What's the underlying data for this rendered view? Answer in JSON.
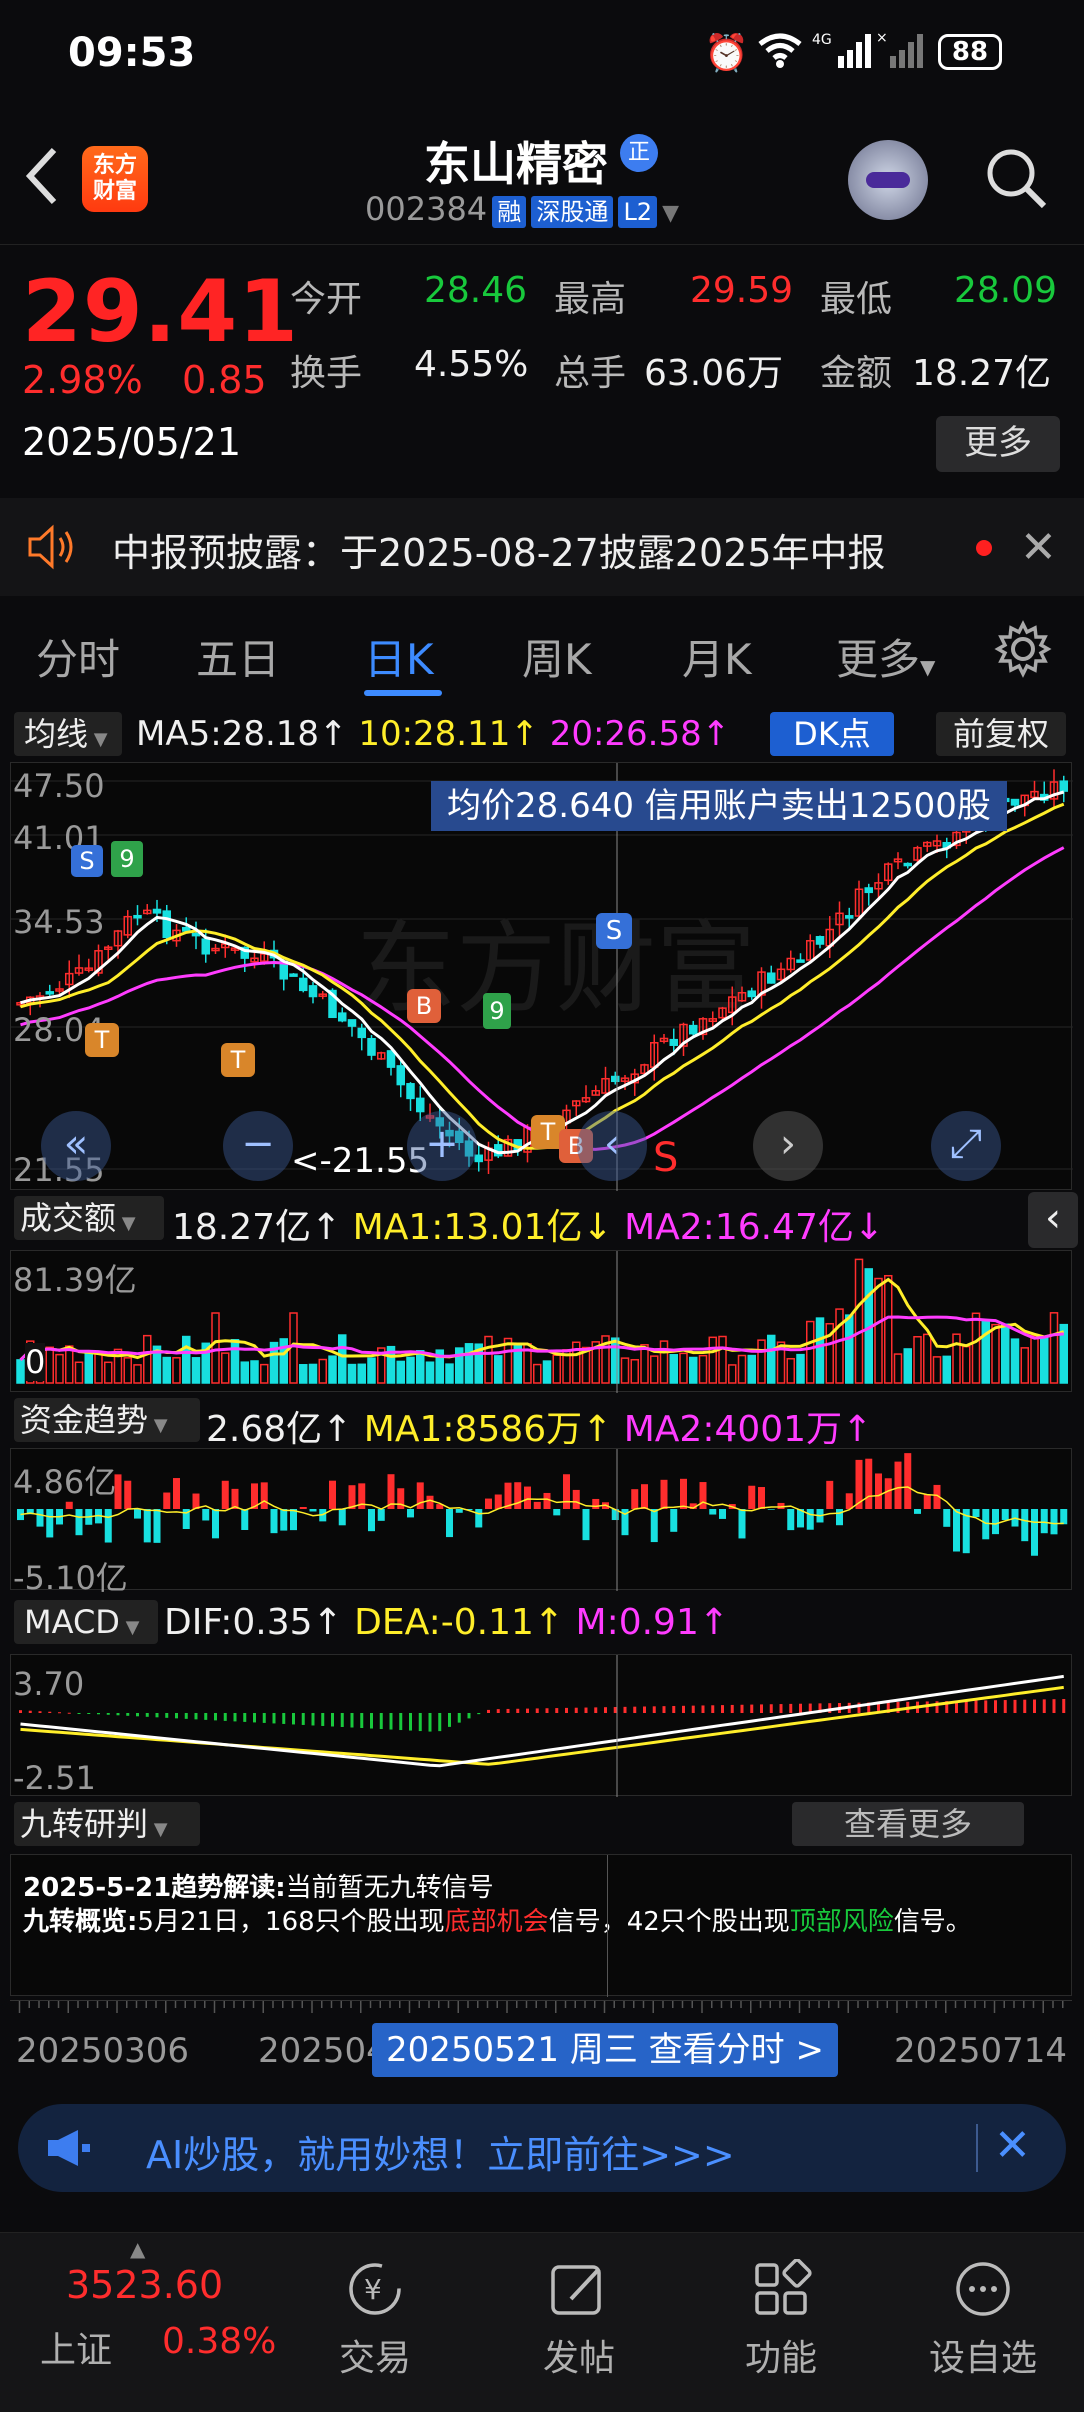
{
  "status": {
    "time": "09:53",
    "battery": "88",
    "signal_label": "4G"
  },
  "header": {
    "logo_line1": "东方",
    "logo_line2": "财富",
    "stock_name": "东山精密",
    "stock_badge": "正",
    "stock_code": "002384",
    "tags": [
      "融",
      "深股通",
      "L2"
    ]
  },
  "quote": {
    "price": "29.41",
    "change_pct": "2.98%",
    "change": "0.85",
    "date": "2025/05/21",
    "open_label": "今开",
    "open": "28.46",
    "high_label": "最高",
    "high": "29.59",
    "low_label": "最低",
    "low": "28.09",
    "turnover_label": "换手",
    "turnover": "4.55%",
    "volume_label": "总手",
    "volume": "63.06万",
    "amount_label": "金额",
    "amount": "18.27亿",
    "more_label": "更多"
  },
  "notice": {
    "text": "中报预披露：于2025-08-27披露2025年中报"
  },
  "tabs": {
    "items": [
      "分时",
      "五日",
      "日K",
      "周K",
      "月K",
      "更多"
    ],
    "active": "日K"
  },
  "kline": {
    "indicator": "均线",
    "ma5": "MA5:28.18",
    "ma5_arrow": "↑",
    "ma10": "10:28.11",
    "ma10_arrow": "↑",
    "ma20": "20:26.58",
    "ma20_arrow": "↑",
    "dk_label": "DK点",
    "adjust_label": "前复权",
    "y_labels": [
      "47.50",
      "41.01",
      "34.53",
      "28.04",
      "21.55"
    ],
    "banner": "均价28.640  信用账户卖出12500股",
    "high_mark": "47.50",
    "low_mark": "<-21.55",
    "sell_mark": "S"
  },
  "volume": {
    "title": "成交额",
    "value": "18.27亿",
    "ma1": "MA1:13.01亿",
    "ma1_arrow": "↓",
    "ma2": "MA2:16.47亿",
    "ma2_arrow": "↓",
    "y_top": "81.39亿",
    "y_bottom": "0"
  },
  "fund": {
    "title": "资金趋势",
    "value": "2.68亿",
    "ma1": "MA1:8586万",
    "ma2": "MA2:4001万",
    "y_top": "4.86亿",
    "y_bottom": "-5.10亿"
  },
  "macd": {
    "title": "MACD",
    "dif": "DIF:0.35",
    "dea": "DEA:-0.11",
    "m": "M:0.91",
    "y_top": "3.70",
    "y_bottom": "-2.51"
  },
  "nine": {
    "title": "九转研判",
    "more": "查看更多",
    "line1_label": "2025-5-21趋势解读:",
    "line1_text": "当前暂无九转信号",
    "line2_label": "九转概览:",
    "line2_a": "5月21日，168只个股出现",
    "line2_red": "底部机会",
    "line2_b": "信号，42只个股出现",
    "line2_green": "顶部风险",
    "line2_c": "信号。"
  },
  "timeline": {
    "left": "20250306",
    "mid": "202504",
    "current": "20250521 周三 查看分时 >",
    "right": "20250714"
  },
  "ad": {
    "text": "AI炒股，就用妙想！立即前往>>>"
  },
  "bottom": {
    "index_value": "3523.60",
    "index_name": "上证",
    "index_pct": "0.38%",
    "items": [
      {
        "label": "交易",
        "icon": "trade-icon"
      },
      {
        "label": "发帖",
        "icon": "post-icon"
      },
      {
        "label": "功能",
        "icon": "apps-icon"
      },
      {
        "label": "设自选",
        "icon": "favorite-icon"
      }
    ]
  },
  "colors": {
    "up": "#ff2d2d",
    "down": "#18e0e0",
    "ma5": "#ffffff",
    "ma10": "#ffee2a",
    "ma20": "#ff3cff",
    "accent": "#1d5fd1"
  }
}
